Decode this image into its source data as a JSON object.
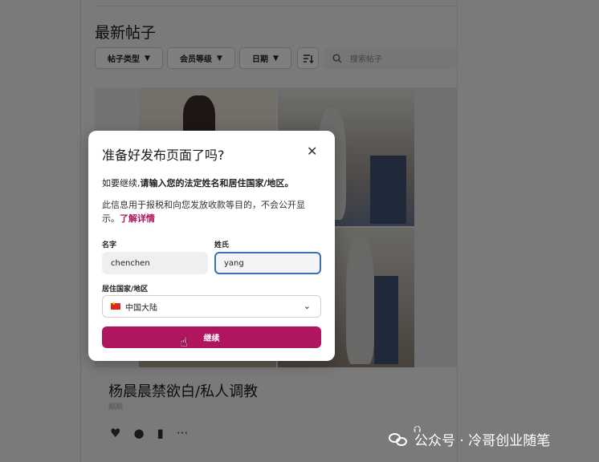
{
  "page": {
    "section_title": "最新帖子",
    "filters": [
      "帖子类型",
      "会员等级",
      "日期"
    ],
    "filter_chevron": "⌄",
    "sort_icon": "sort-icon",
    "search_placeholder": "搜索帖子",
    "post_title": "杨晨晨禁欲白/私人调教",
    "post_subtitle": "刚刚",
    "actions": [
      "heart-icon",
      "comment-icon",
      "stats-icon",
      "more-icon"
    ]
  },
  "modal": {
    "title": "准备好发布页面了吗?",
    "close": "✕",
    "p1_prefix": "如要继续,",
    "p1_bold": "请输入您的法定姓名和居住国家/地区。",
    "p2_text": "此信息用于报税和向您发放收款等目的，不会公开显示。",
    "p2_link": "了解详情",
    "first_name_label": "名字",
    "first_name_value": "chenchen",
    "last_name_label": "姓氏",
    "last_name_value": "yang",
    "country_label": "居住国家/地区",
    "country_value": "中国大陆",
    "continue_label": "继续"
  },
  "watermark": {
    "text": "公众号 · 冷哥创业随笔"
  },
  "colors": {
    "accent": "#b0165e",
    "focus_border": "#3c6fb5"
  }
}
